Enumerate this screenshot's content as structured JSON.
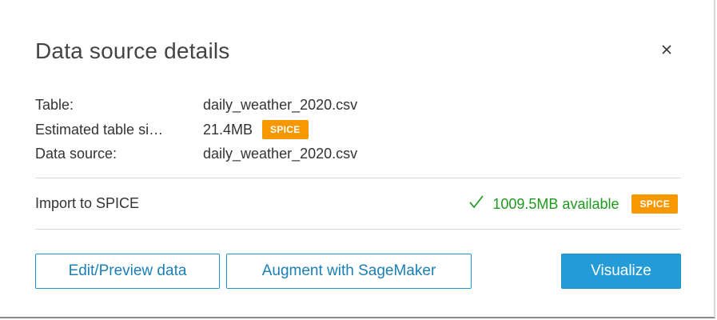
{
  "dialog": {
    "title": "Data source details",
    "close_icon": "close-icon"
  },
  "details": {
    "table_label": "Table:",
    "table_value": "daily_weather_2020.csv",
    "size_label": "Estimated table si…",
    "size_value": "21.4MB",
    "size_badge": "SPICE",
    "source_label": "Data source:",
    "source_value": "daily_weather_2020.csv"
  },
  "import": {
    "label": "Import to SPICE",
    "check_icon": "check-icon",
    "available": "1009.5MB available",
    "badge": "SPICE"
  },
  "actions": {
    "edit_label": "Edit/Preview data",
    "augment_label": "Augment with SageMaker",
    "visualize_label": "Visualize"
  },
  "colors": {
    "accent": "#229bd6",
    "badge": "#f79800",
    "success": "#1d9a1d"
  }
}
